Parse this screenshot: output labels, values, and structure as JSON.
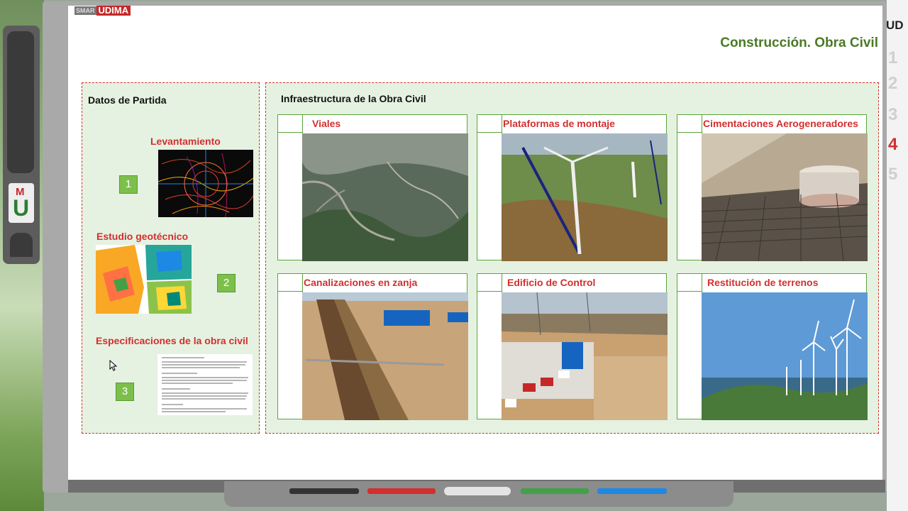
{
  "branding": {
    "smart_label": "SMAR",
    "udima_label": "UDIMA"
  },
  "slide": {
    "title": "Construcción. Obra Civil",
    "left_panel": {
      "title": "Datos de Partida",
      "items": [
        {
          "label": "Levantamiento",
          "number": "1"
        },
        {
          "label": "Estudio geotécnico",
          "number": "2"
        },
        {
          "label": "Especificaciones de la obra civil",
          "number": "3"
        }
      ]
    },
    "right_panel": {
      "title": "Infraestructura de la Obra Civil",
      "cards": [
        {
          "title": "Viales"
        },
        {
          "title": "Plataformas de montaje"
        },
        {
          "title": "Cimentaciones Aerogeneradores"
        },
        {
          "title": "Canalizaciones en zanja"
        },
        {
          "title": "Edificio de Control"
        },
        {
          "title": "Restitución de terrenos"
        }
      ]
    }
  },
  "side_nav": {
    "header": "UD",
    "items": [
      "1",
      "2",
      "3",
      "4",
      "5"
    ],
    "active_index": 3
  },
  "colors": {
    "accent_red": "#d32f2f",
    "title_green": "#4a7a26",
    "panel_bg": "#e6f2e1",
    "badge_green": "#7cbf4a"
  }
}
